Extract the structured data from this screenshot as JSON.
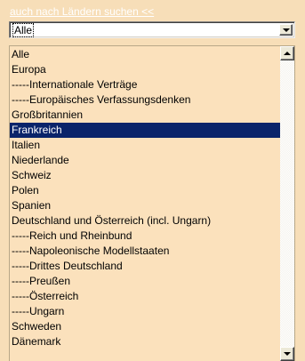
{
  "search_link": "auch nach Ländern suchen <<",
  "select": {
    "value": "Alle"
  },
  "listbox": {
    "selected_index": 5,
    "options": [
      "Alle",
      "Europa",
      "-----Internationale Verträge",
      "-----Europäisches Verfassungsdenken",
      "Großbritannien",
      "Frankreich",
      "Italien",
      "Niederlande",
      "Schweiz",
      "Polen",
      "Spanien",
      "Deutschland und Österreich (incl. Ungarn)",
      "-----Reich und Rheinbund",
      "-----Napoleonische Modellstaaten",
      "-----Drittes Deutschland",
      "-----Preußen",
      "-----Österreich",
      "-----Ungarn",
      "Schweden",
      "Dänemark"
    ]
  },
  "colors": {
    "background": "#f7deb8",
    "list_background": "#fbe1bc",
    "selection": "#0a246a",
    "link": "#ffffff"
  },
  "icons": {
    "dropdown": "chevron-down-icon",
    "scroll_up": "arrow-up-icon",
    "scroll_down": "arrow-down-icon"
  }
}
